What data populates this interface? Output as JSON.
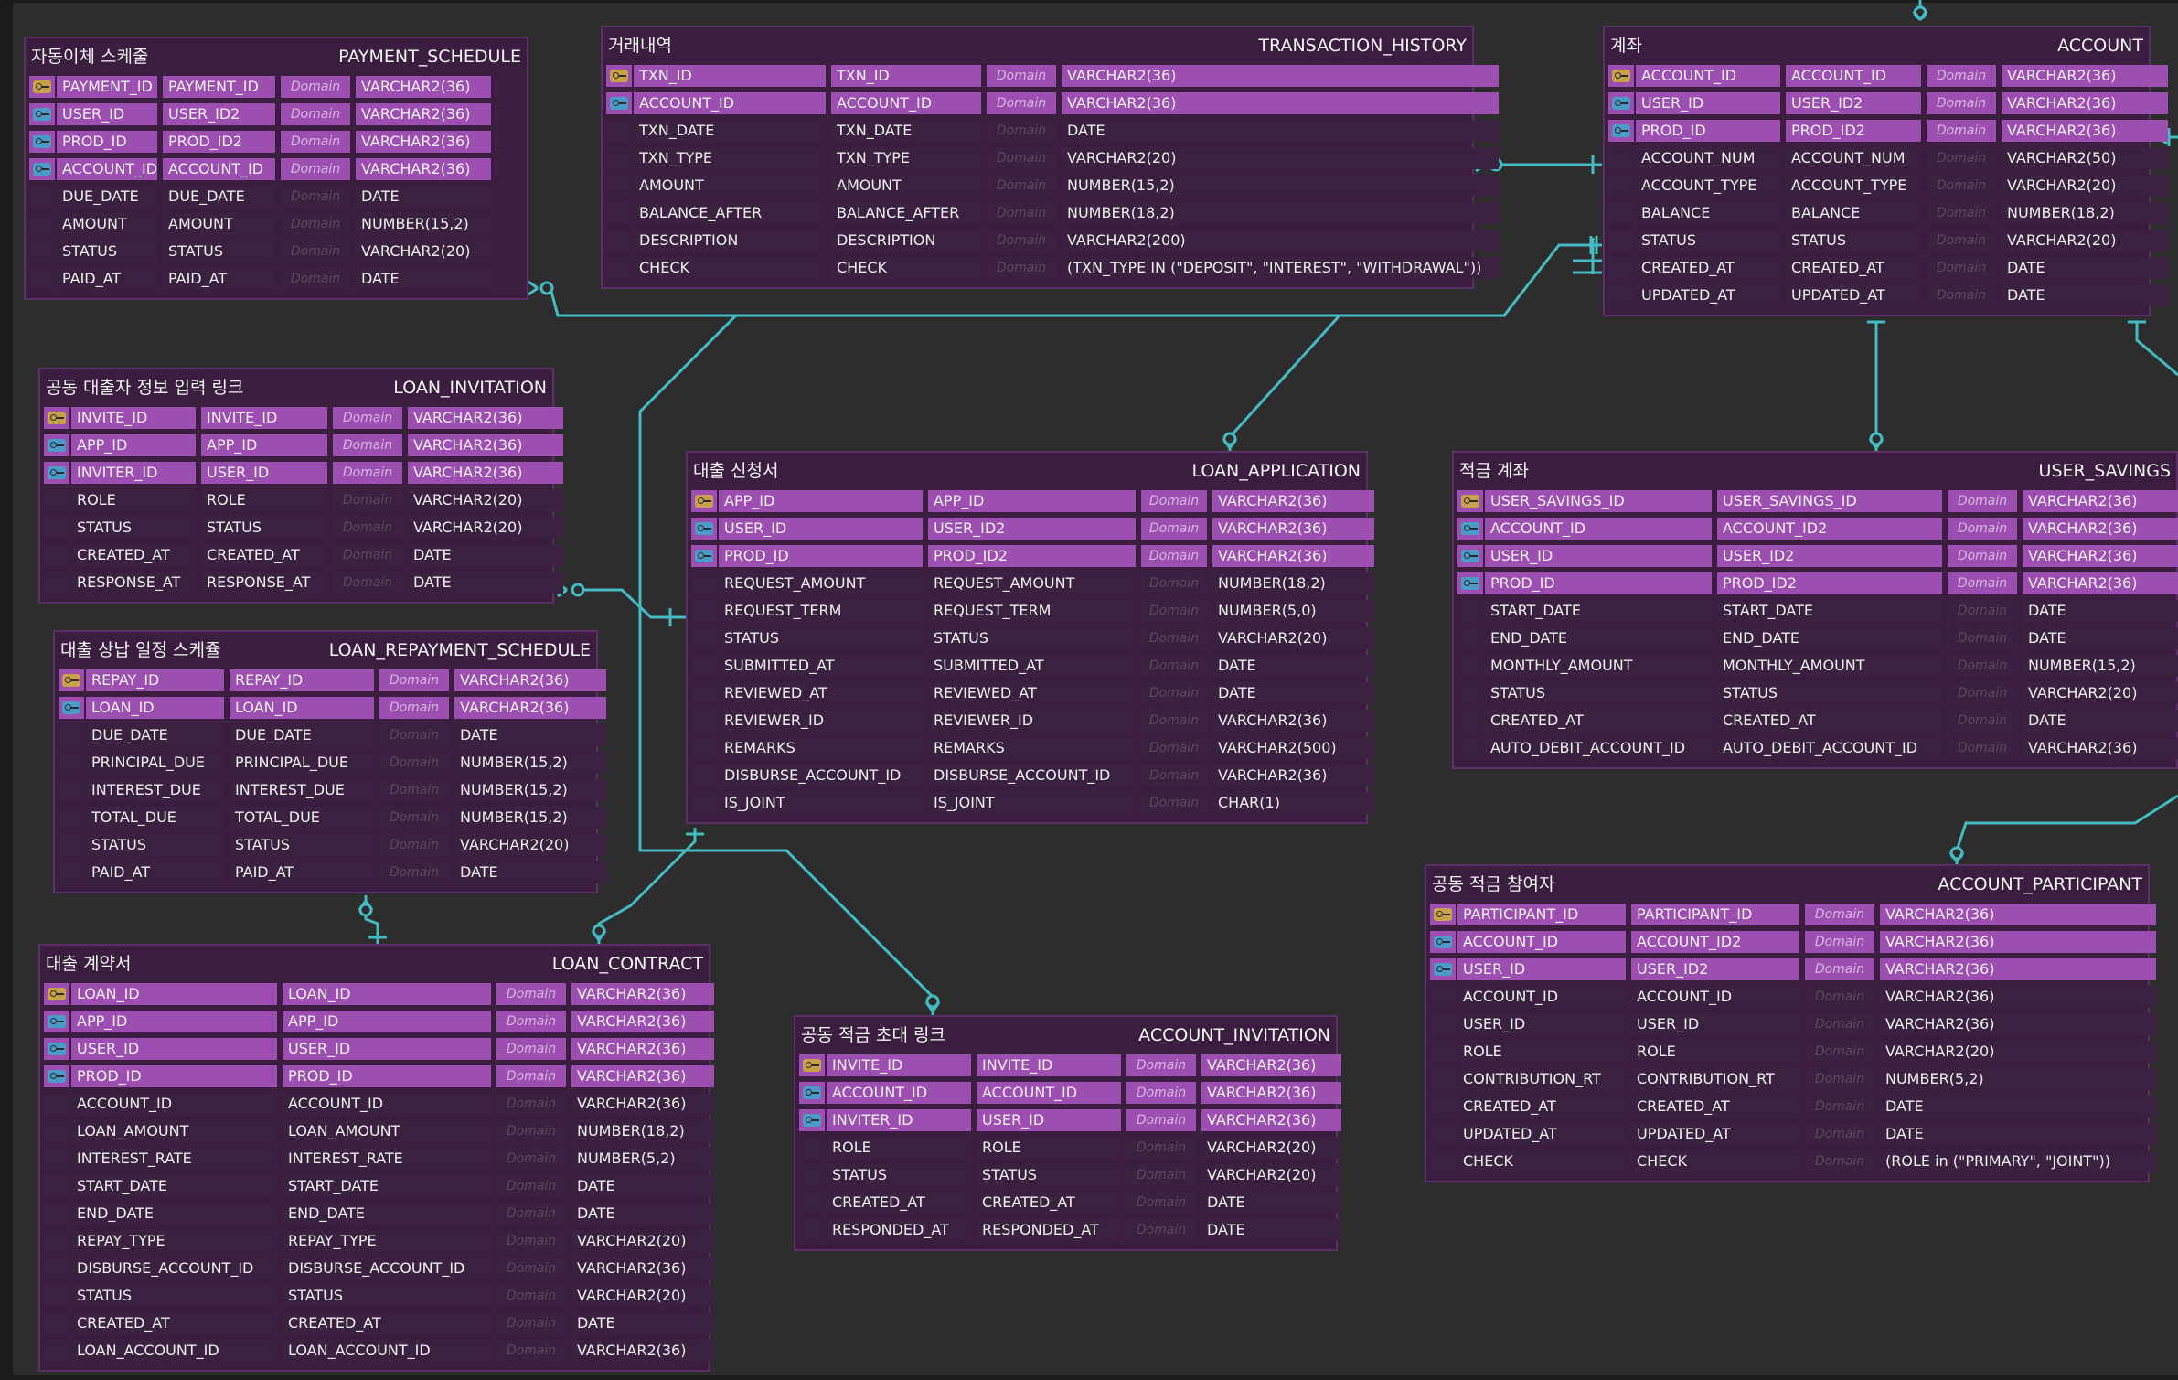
{
  "link_color": "#45bcc4",
  "tables": [
    {
      "id": "payment_schedule",
      "title": "자동이체 스케줄",
      "name": "PAYMENT_SCHEDULE",
      "rows": [
        {
          "icon": "pk",
          "logical": "PAYMENT_ID",
          "physical": "PAYMENT_ID",
          "domain": "Domain",
          "type": "VARCHAR2(36)"
        },
        {
          "icon": "fk",
          "logical": "USER_ID",
          "physical": "USER_ID2",
          "domain": "Domain",
          "type": "VARCHAR2(36)"
        },
        {
          "icon": "fk",
          "logical": "PROD_ID",
          "physical": "PROD_ID2",
          "domain": "Domain",
          "type": "VARCHAR2(36)"
        },
        {
          "icon": "fk",
          "logical": "ACCOUNT_ID",
          "physical": "ACCOUNT_ID",
          "domain": "Domain",
          "type": "VARCHAR2(36)"
        },
        {
          "icon": "",
          "logical": "DUE_DATE",
          "physical": "DUE_DATE",
          "domain": "Domain",
          "type": "DATE"
        },
        {
          "icon": "",
          "logical": "AMOUNT",
          "physical": "AMOUNT",
          "domain": "Domain",
          "type": "NUMBER(15,2)"
        },
        {
          "icon": "",
          "logical": "STATUS",
          "physical": "STATUS",
          "domain": "Domain",
          "type": "VARCHAR2(20)"
        },
        {
          "icon": "",
          "logical": "PAID_AT",
          "physical": "PAID_AT",
          "domain": "Domain",
          "type": "DATE"
        }
      ]
    },
    {
      "id": "transaction_history",
      "title": "거래내역",
      "name": "TRANSACTION_HISTORY",
      "rows": [
        {
          "icon": "pk",
          "logical": "TXN_ID",
          "physical": "TXN_ID",
          "domain": "Domain",
          "type": "VARCHAR2(36)"
        },
        {
          "icon": "fk",
          "logical": "ACCOUNT_ID",
          "physical": "ACCOUNT_ID",
          "domain": "Domain",
          "type": "VARCHAR2(36)"
        },
        {
          "icon": "",
          "logical": "TXN_DATE",
          "physical": "TXN_DATE",
          "domain": "Domain",
          "type": "DATE"
        },
        {
          "icon": "",
          "logical": "TXN_TYPE",
          "physical": "TXN_TYPE",
          "domain": "Domain",
          "type": "VARCHAR2(20)"
        },
        {
          "icon": "",
          "logical": "AMOUNT",
          "physical": "AMOUNT",
          "domain": "Domain",
          "type": "NUMBER(15,2)"
        },
        {
          "icon": "",
          "logical": "BALANCE_AFTER",
          "physical": "BALANCE_AFTER",
          "domain": "Domain",
          "type": "NUMBER(18,2)"
        },
        {
          "icon": "",
          "logical": "DESCRIPTION",
          "physical": "DESCRIPTION",
          "domain": "Domain",
          "type": "VARCHAR2(200)"
        },
        {
          "icon": "",
          "logical": "CHECK",
          "physical": "CHECK",
          "domain": "Domain",
          "type": "(TXN_TYPE IN (\"DEPOSIT\", \"INTEREST\", \"WITHDRAWAL\"))"
        }
      ]
    },
    {
      "id": "account",
      "title": "계좌",
      "name": "ACCOUNT",
      "rows": [
        {
          "icon": "pk",
          "logical": "ACCOUNT_ID",
          "physical": "ACCOUNT_ID",
          "domain": "Domain",
          "type": "VARCHAR2(36)"
        },
        {
          "icon": "fk",
          "logical": "USER_ID",
          "physical": "USER_ID2",
          "domain": "Domain",
          "type": "VARCHAR2(36)"
        },
        {
          "icon": "fk",
          "logical": "PROD_ID",
          "physical": "PROD_ID2",
          "domain": "Domain",
          "type": "VARCHAR2(36)"
        },
        {
          "icon": "",
          "logical": "ACCOUNT_NUM",
          "physical": "ACCOUNT_NUM",
          "domain": "Domain",
          "type": "VARCHAR2(50)"
        },
        {
          "icon": "",
          "logical": "ACCOUNT_TYPE",
          "physical": "ACCOUNT_TYPE",
          "domain": "Domain",
          "type": "VARCHAR2(20)"
        },
        {
          "icon": "",
          "logical": "BALANCE",
          "physical": "BALANCE",
          "domain": "Domain",
          "type": "NUMBER(18,2)"
        },
        {
          "icon": "",
          "logical": "STATUS",
          "physical": "STATUS",
          "domain": "Domain",
          "type": "VARCHAR2(20)"
        },
        {
          "icon": "",
          "logical": "CREATED_AT",
          "physical": "CREATED_AT",
          "domain": "Domain",
          "type": "DATE"
        },
        {
          "icon": "",
          "logical": "UPDATED_AT",
          "physical": "UPDATED_AT",
          "domain": "Domain",
          "type": "DATE"
        }
      ]
    },
    {
      "id": "loan_invitation",
      "title": "공동 대출자 정보 입력 링크",
      "name": "LOAN_INVITATION",
      "rows": [
        {
          "icon": "pk",
          "logical": "INVITE_ID",
          "physical": "INVITE_ID",
          "domain": "Domain",
          "type": "VARCHAR2(36)"
        },
        {
          "icon": "fk",
          "logical": "APP_ID",
          "physical": "APP_ID",
          "domain": "Domain",
          "type": "VARCHAR2(36)"
        },
        {
          "icon": "fk",
          "logical": "INVITER_ID",
          "physical": "USER_ID",
          "domain": "Domain",
          "type": "VARCHAR2(36)"
        },
        {
          "icon": "",
          "logical": "ROLE",
          "physical": "ROLE",
          "domain": "Domain",
          "type": "VARCHAR2(20)"
        },
        {
          "icon": "",
          "logical": "STATUS",
          "physical": "STATUS",
          "domain": "Domain",
          "type": "VARCHAR2(20)"
        },
        {
          "icon": "",
          "logical": "CREATED_AT",
          "physical": "CREATED_AT",
          "domain": "Domain",
          "type": "DATE"
        },
        {
          "icon": "",
          "logical": "RESPONSE_AT",
          "physical": "RESPONSE_AT",
          "domain": "Domain",
          "type": "DATE"
        }
      ]
    },
    {
      "id": "loan_application",
      "title": "대출 신청서",
      "name": "LOAN_APPLICATION",
      "rows": [
        {
          "icon": "pk",
          "logical": "APP_ID",
          "physical": "APP_ID",
          "domain": "Domain",
          "type": "VARCHAR2(36)"
        },
        {
          "icon": "fk",
          "logical": "USER_ID",
          "physical": "USER_ID2",
          "domain": "Domain",
          "type": "VARCHAR2(36)"
        },
        {
          "icon": "fk",
          "logical": "PROD_ID",
          "physical": "PROD_ID2",
          "domain": "Domain",
          "type": "VARCHAR2(36)"
        },
        {
          "icon": "",
          "logical": "REQUEST_AMOUNT",
          "physical": "REQUEST_AMOUNT",
          "domain": "Domain",
          "type": "NUMBER(18,2)"
        },
        {
          "icon": "",
          "logical": "REQUEST_TERM",
          "physical": "REQUEST_TERM",
          "domain": "Domain",
          "type": "NUMBER(5,0)"
        },
        {
          "icon": "",
          "logical": "STATUS",
          "physical": "STATUS",
          "domain": "Domain",
          "type": "VARCHAR2(20)"
        },
        {
          "icon": "",
          "logical": "SUBMITTED_AT",
          "physical": "SUBMITTED_AT",
          "domain": "Domain",
          "type": "DATE"
        },
        {
          "icon": "",
          "logical": "REVIEWED_AT",
          "physical": "REVIEWED_AT",
          "domain": "Domain",
          "type": "DATE"
        },
        {
          "icon": "",
          "logical": "REVIEWER_ID",
          "physical": "REVIEWER_ID",
          "domain": "Domain",
          "type": "VARCHAR2(36)"
        },
        {
          "icon": "",
          "logical": "REMARKS",
          "physical": "REMARKS",
          "domain": "Domain",
          "type": "VARCHAR2(500)"
        },
        {
          "icon": "",
          "logical": "DISBURSE_ACCOUNT_ID",
          "physical": "DISBURSE_ACCOUNT_ID",
          "domain": "Domain",
          "type": "VARCHAR2(36)"
        },
        {
          "icon": "",
          "logical": "IS_JOINT",
          "physical": "IS_JOINT",
          "domain": "Domain",
          "type": "CHAR(1)"
        }
      ]
    },
    {
      "id": "user_savings",
      "title": "적금 계좌",
      "name": "USER_SAVINGS",
      "rows": [
        {
          "icon": "pk",
          "logical": "USER_SAVINGS_ID",
          "physical": "USER_SAVINGS_ID",
          "domain": "Domain",
          "type": "VARCHAR2(36)"
        },
        {
          "icon": "fk",
          "logical": "ACCOUNT_ID",
          "physical": "ACCOUNT_ID2",
          "domain": "Domain",
          "type": "VARCHAR2(36)"
        },
        {
          "icon": "fk",
          "logical": "USER_ID",
          "physical": "USER_ID2",
          "domain": "Domain",
          "type": "VARCHAR2(36)"
        },
        {
          "icon": "fk",
          "logical": "PROD_ID",
          "physical": "PROD_ID2",
          "domain": "Domain",
          "type": "VARCHAR2(36)"
        },
        {
          "icon": "",
          "logical": "START_DATE",
          "physical": "START_DATE",
          "domain": "Domain",
          "type": "DATE"
        },
        {
          "icon": "",
          "logical": "END_DATE",
          "physical": "END_DATE",
          "domain": "Domain",
          "type": "DATE"
        },
        {
          "icon": "",
          "logical": "MONTHLY_AMOUNT",
          "physical": "MONTHLY_AMOUNT",
          "domain": "Domain",
          "type": "NUMBER(15,2)"
        },
        {
          "icon": "",
          "logical": "STATUS",
          "physical": "STATUS",
          "domain": "Domain",
          "type": "VARCHAR2(20)"
        },
        {
          "icon": "",
          "logical": "CREATED_AT",
          "physical": "CREATED_AT",
          "domain": "Domain",
          "type": "DATE"
        },
        {
          "icon": "",
          "logical": "AUTO_DEBIT_ACCOUNT_ID",
          "physical": "AUTO_DEBIT_ACCOUNT_ID",
          "domain": "Domain",
          "type": "VARCHAR2(36)"
        }
      ]
    },
    {
      "id": "loan_repayment_schedule",
      "title": "대출 상납 일정 스케쥴",
      "name": "LOAN_REPAYMENT_SCHEDULE",
      "rows": [
        {
          "icon": "pk",
          "logical": "REPAY_ID",
          "physical": "REPAY_ID",
          "domain": "Domain",
          "type": "VARCHAR2(36)"
        },
        {
          "icon": "fk",
          "logical": "LOAN_ID",
          "physical": "LOAN_ID",
          "domain": "Domain",
          "type": "VARCHAR2(36)"
        },
        {
          "icon": "",
          "logical": "DUE_DATE",
          "physical": "DUE_DATE",
          "domain": "Domain",
          "type": "DATE"
        },
        {
          "icon": "",
          "logical": "PRINCIPAL_DUE",
          "physical": "PRINCIPAL_DUE",
          "domain": "Domain",
          "type": "NUMBER(15,2)"
        },
        {
          "icon": "",
          "logical": "INTEREST_DUE",
          "physical": "INTEREST_DUE",
          "domain": "Domain",
          "type": "NUMBER(15,2)"
        },
        {
          "icon": "",
          "logical": "TOTAL_DUE",
          "physical": "TOTAL_DUE",
          "domain": "Domain",
          "type": "NUMBER(15,2)"
        },
        {
          "icon": "",
          "logical": "STATUS",
          "physical": "STATUS",
          "domain": "Domain",
          "type": "VARCHAR2(20)"
        },
        {
          "icon": "",
          "logical": "PAID_AT",
          "physical": "PAID_AT",
          "domain": "Domain",
          "type": "DATE"
        }
      ]
    },
    {
      "id": "account_participant",
      "title": "공동 적금 참여자",
      "name": "ACCOUNT_PARTICIPANT",
      "rows": [
        {
          "icon": "pk",
          "logical": "PARTICIPANT_ID",
          "physical": "PARTICIPANT_ID",
          "domain": "Domain",
          "type": "VARCHAR2(36)"
        },
        {
          "icon": "fk",
          "logical": "ACCOUNT_ID",
          "physical": "ACCOUNT_ID2",
          "domain": "Domain",
          "type": "VARCHAR2(36)"
        },
        {
          "icon": "fk",
          "logical": "USER_ID",
          "physical": "USER_ID2",
          "domain": "Domain",
          "type": "VARCHAR2(36)"
        },
        {
          "icon": "",
          "logical": "ACCOUNT_ID",
          "physical": "ACCOUNT_ID",
          "domain": "Domain",
          "type": "VARCHAR2(36)"
        },
        {
          "icon": "",
          "logical": "USER_ID",
          "physical": "USER_ID",
          "domain": "Domain",
          "type": "VARCHAR2(36)"
        },
        {
          "icon": "",
          "logical": "ROLE",
          "physical": "ROLE",
          "domain": "Domain",
          "type": "VARCHAR2(20)"
        },
        {
          "icon": "",
          "logical": "CONTRIBUTION_RT",
          "physical": "CONTRIBUTION_RT",
          "domain": "Domain",
          "type": "NUMBER(5,2)"
        },
        {
          "icon": "",
          "logical": "CREATED_AT",
          "physical": "CREATED_AT",
          "domain": "Domain",
          "type": "DATE"
        },
        {
          "icon": "",
          "logical": "UPDATED_AT",
          "physical": "UPDATED_AT",
          "domain": "Domain",
          "type": "DATE"
        },
        {
          "icon": "",
          "logical": "CHECK",
          "physical": "CHECK",
          "domain": "Domain",
          "type": "(ROLE in (\"PRIMARY\", \"JOINT\"))"
        }
      ]
    },
    {
      "id": "loan_contract",
      "title": "대출 계약서",
      "name": "LOAN_CONTRACT",
      "rows": [
        {
          "icon": "pk",
          "logical": "LOAN_ID",
          "physical": "LOAN_ID",
          "domain": "Domain",
          "type": "VARCHAR2(36)"
        },
        {
          "icon": "fk",
          "logical": "APP_ID",
          "physical": "APP_ID",
          "domain": "Domain",
          "type": "VARCHAR2(36)"
        },
        {
          "icon": "fk",
          "logical": "USER_ID",
          "physical": "USER_ID",
          "domain": "Domain",
          "type": "VARCHAR2(36)"
        },
        {
          "icon": "fk",
          "logical": "PROD_ID",
          "physical": "PROD_ID",
          "domain": "Domain",
          "type": "VARCHAR2(36)"
        },
        {
          "icon": "",
          "logical": "ACCOUNT_ID",
          "physical": "ACCOUNT_ID",
          "domain": "Domain",
          "type": "VARCHAR2(36)"
        },
        {
          "icon": "",
          "logical": "LOAN_AMOUNT",
          "physical": "LOAN_AMOUNT",
          "domain": "Domain",
          "type": "NUMBER(18,2)"
        },
        {
          "icon": "",
          "logical": "INTEREST_RATE",
          "physical": "INTEREST_RATE",
          "domain": "Domain",
          "type": "NUMBER(5,2)"
        },
        {
          "icon": "",
          "logical": "START_DATE",
          "physical": "START_DATE",
          "domain": "Domain",
          "type": "DATE"
        },
        {
          "icon": "",
          "logical": "END_DATE",
          "physical": "END_DATE",
          "domain": "Domain",
          "type": "DATE"
        },
        {
          "icon": "",
          "logical": "REPAY_TYPE",
          "physical": "REPAY_TYPE",
          "domain": "Domain",
          "type": "VARCHAR2(20)"
        },
        {
          "icon": "",
          "logical": "DISBURSE_ACCOUNT_ID",
          "physical": "DISBURSE_ACCOUNT_ID",
          "domain": "Domain",
          "type": "VARCHAR2(36)"
        },
        {
          "icon": "",
          "logical": "STATUS",
          "physical": "STATUS",
          "domain": "Domain",
          "type": "VARCHAR2(20)"
        },
        {
          "icon": "",
          "logical": "CREATED_AT",
          "physical": "CREATED_AT",
          "domain": "Domain",
          "type": "DATE"
        },
        {
          "icon": "",
          "logical": "LOAN_ACCOUNT_ID",
          "physical": "LOAN_ACCOUNT_ID",
          "domain": "Domain",
          "type": "VARCHAR2(36)"
        }
      ]
    },
    {
      "id": "account_invitation",
      "title": "공동 적금 초대 링크",
      "name": "ACCOUNT_INVITATION",
      "rows": [
        {
          "icon": "pk",
          "logical": "INVITE_ID",
          "physical": "INVITE_ID",
          "domain": "Domain",
          "type": "VARCHAR2(36)"
        },
        {
          "icon": "fk",
          "logical": "ACCOUNT_ID",
          "physical": "ACCOUNT_ID",
          "domain": "Domain",
          "type": "VARCHAR2(36)"
        },
        {
          "icon": "fk",
          "logical": "INVITER_ID",
          "physical": "USER_ID",
          "domain": "Domain",
          "type": "VARCHAR2(36)"
        },
        {
          "icon": "",
          "logical": "ROLE",
          "physical": "ROLE",
          "domain": "Domain",
          "type": "VARCHAR2(20)"
        },
        {
          "icon": "",
          "logical": "STATUS",
          "physical": "STATUS",
          "domain": "Domain",
          "type": "VARCHAR2(20)"
        },
        {
          "icon": "",
          "logical": "CREATED_AT",
          "physical": "CREATED_AT",
          "domain": "Domain",
          "type": "DATE"
        },
        {
          "icon": "",
          "logical": "RESPONDED_AT",
          "physical": "RESPONDED_AT",
          "domain": "Domain",
          "type": "DATE"
        }
      ]
    }
  ]
}
